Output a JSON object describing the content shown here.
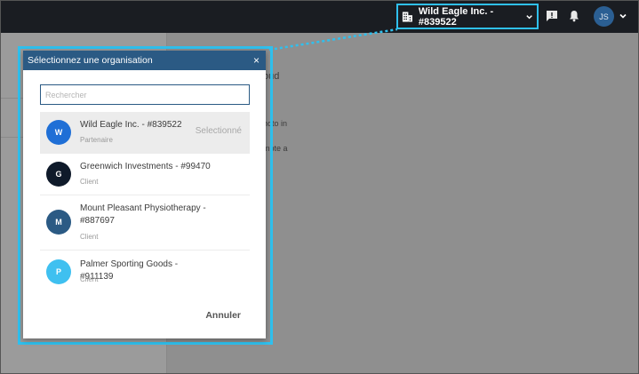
{
  "topbar": {
    "org_switcher_label": "Wild Eagle Inc. - #839522",
    "user_initials": "JS"
  },
  "background": {
    "title_fragment": "oud",
    "row1_fragment": "hoto in",
    "row2_fragment": "mpte a"
  },
  "modal": {
    "title": "Sélectionnez une organisation",
    "close_label": "×",
    "search_placeholder": "Rechercher",
    "cancel_label": "Annuler",
    "organizations": [
      {
        "initial": "W",
        "name": "Wild Eagle Inc. - #839522",
        "type": "Partenaire",
        "selected_label": "Selectionné",
        "color": "#1f6fd6"
      },
      {
        "initial": "G",
        "name": "Greenwich Investments - #99470",
        "type": "Client",
        "color": "#0f1a2a"
      },
      {
        "initial": "M",
        "name": "Mount Pleasant Physiotherapy - #887697",
        "type": "Client",
        "color": "#2b5a84"
      },
      {
        "initial": "P",
        "name": "Palmer Sporting Goods - #911139",
        "type": "Client",
        "color": "#3fc0f0"
      }
    ]
  },
  "colors": {
    "highlight": "#2fc0ee",
    "modal_header": "#2b5a84",
    "topbar": "#1a1d22"
  }
}
